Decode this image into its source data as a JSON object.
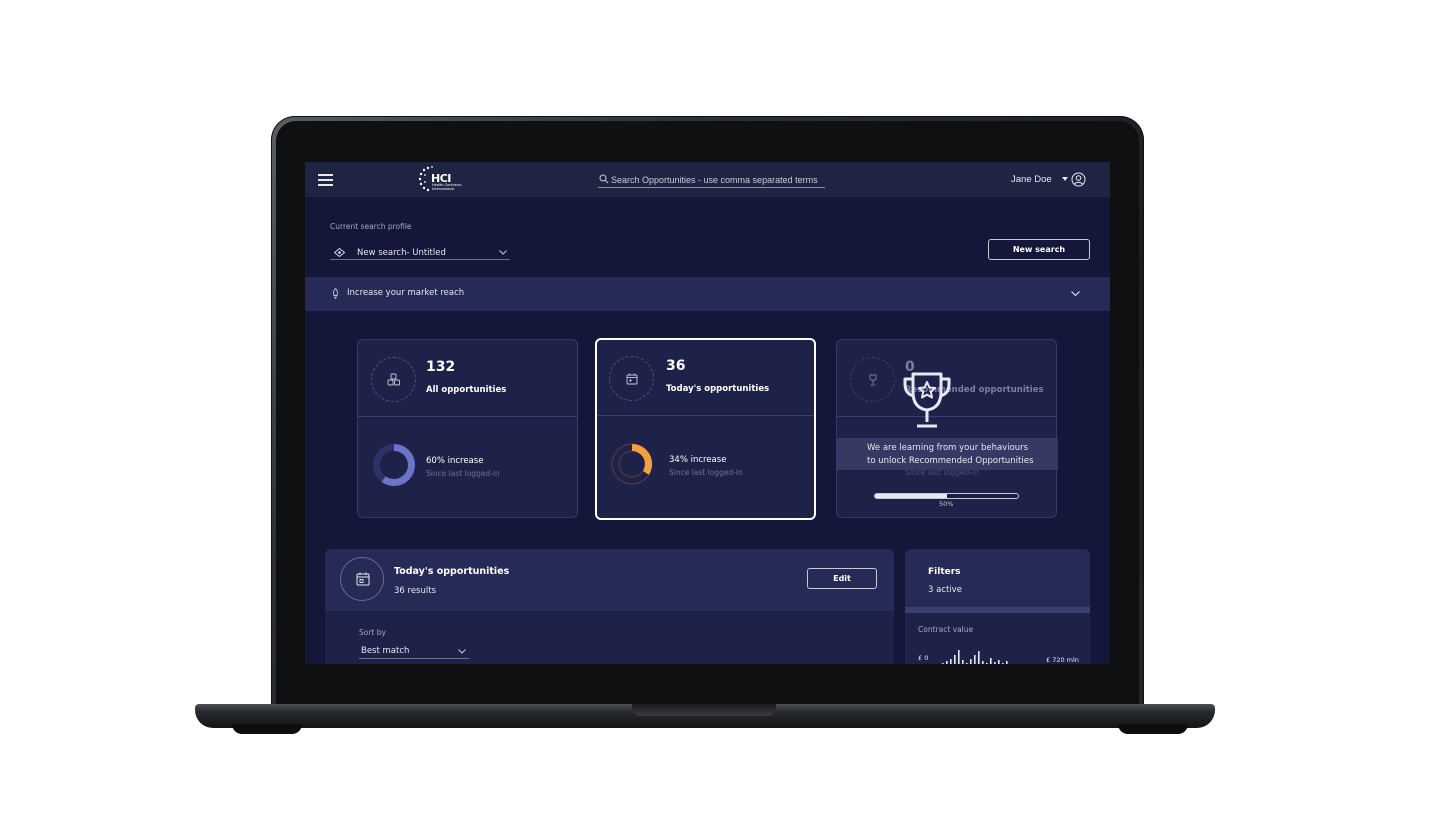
{
  "topbar": {
    "logo_text": "HCI",
    "logo_subtext": "Health Contracts International",
    "search_placeholder": "Search Opportunities - use comma separated terms",
    "user_name": "Jane Doe"
  },
  "profile": {
    "label": "Current search profile",
    "selected": "New search- Untitled",
    "new_search_button": "New search"
  },
  "market_reach": {
    "label": "Increase your market reach"
  },
  "cards": [
    {
      "count": "132",
      "label": "All opportunities",
      "increase": "60% increase",
      "since": "Since last logged-in",
      "fraction": 0.6,
      "color": "#6b74c9"
    },
    {
      "count": "36",
      "label": "Today's opportunities",
      "increase": "34% increase",
      "since": "Since last logged-in",
      "fraction": 0.34,
      "color": "#f0a042"
    },
    {
      "count": "0",
      "label": "Recommended opportunities",
      "since": "Since last logged-in"
    }
  ],
  "learning": {
    "message_line1": "We are learning from your behaviours",
    "message_line2": "to unlock Recommended Opportunities",
    "progress": 0.5,
    "progress_label": "50%"
  },
  "results": {
    "title": "Today's opportunities",
    "count": "36 results",
    "edit_button": "Edit",
    "sort_label": "Sort by",
    "sort_value": "Best match"
  },
  "filters": {
    "title": "Filters",
    "active": "3 active",
    "contract_value_label": "Contract value",
    "min_label": "£ 0",
    "max_label": "£ 720 mln"
  },
  "colors": {
    "screen_bg": "#14163a",
    "topbar_bg": "#202443",
    "card_bg": "#1f2248",
    "accent_blue": "#6b74c9",
    "accent_orange": "#f0a042"
  }
}
